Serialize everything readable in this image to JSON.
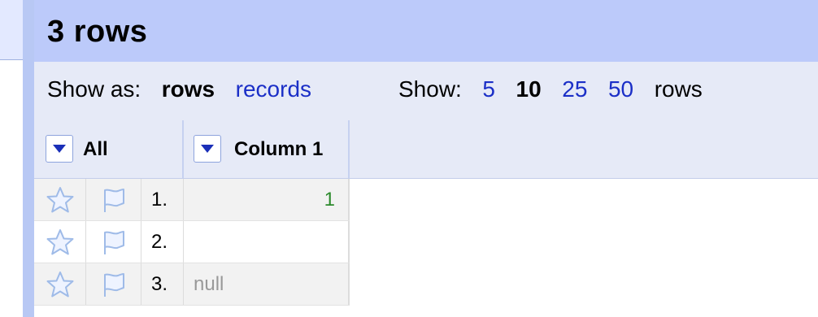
{
  "header": {
    "title": "3 rows"
  },
  "controls": {
    "show_as_label": "Show as:",
    "show_as_options": [
      {
        "label": "rows",
        "current": true
      },
      {
        "label": "records",
        "current": false
      }
    ],
    "show_label": "Show:",
    "page_sizes": [
      {
        "label": "5",
        "current": false
      },
      {
        "label": "10",
        "current": true
      },
      {
        "label": "25",
        "current": false
      },
      {
        "label": "50",
        "current": false
      }
    ],
    "show_suffix": "rows"
  },
  "columns": [
    {
      "name": "All"
    },
    {
      "name": "Column 1"
    }
  ],
  "rows": [
    {
      "index": "1.",
      "value": "1",
      "kind": "number"
    },
    {
      "index": "2.",
      "value": "",
      "kind": "empty"
    },
    {
      "index": "3.",
      "value": "null",
      "kind": "null"
    }
  ],
  "icons": {
    "star": "star-icon",
    "flag": "flag-icon"
  },
  "colors": {
    "header_bg": "#bccafa",
    "link": "#1b2fc7",
    "number_value": "#2c8a2c",
    "null_value": "#999999"
  }
}
